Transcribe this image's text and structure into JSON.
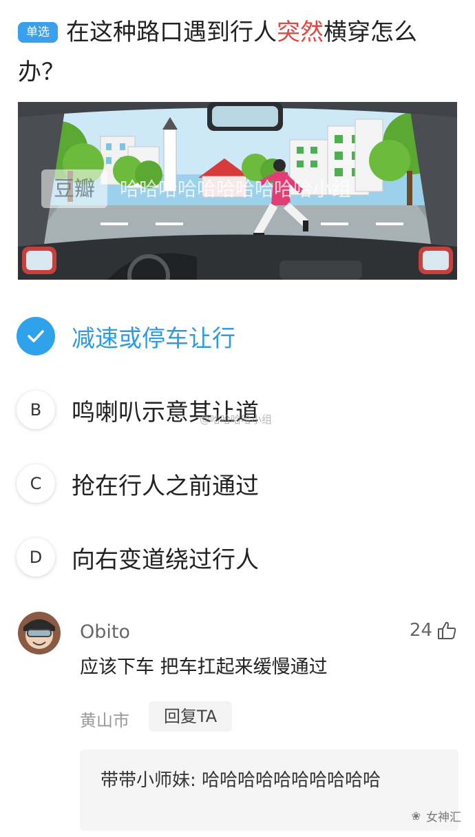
{
  "question": {
    "tag": "单选",
    "text_before": "在这种路口遇到行人",
    "text_highlight": "突然",
    "text_after": "横穿怎么办？",
    "highlight_color": "#e2483d"
  },
  "image": {
    "watermark_logo": "豆瓣",
    "watermark_text": "哈哈哈哈哈哈哈哈哈哈小组"
  },
  "options": [
    {
      "key": "A",
      "text": "减速或停车让行",
      "selected": true
    },
    {
      "key": "B",
      "text": "鸣喇叭示意其让道",
      "selected": false
    },
    {
      "key": "C",
      "text": "抢在行人之前通过",
      "selected": false
    },
    {
      "key": "D",
      "text": "向右变道绕过行人",
      "selected": false
    }
  ],
  "comment": {
    "username": "Obito",
    "likes": "24",
    "text": "应该下车 把车扛起来缓慢通过",
    "location": "黄山市",
    "reply_label": "回复TA",
    "sub_reply": "带带小师妹: 哈哈哈哈哈哈哈哈哈哈"
  },
  "watermarks": {
    "center": "@哈哈哈哈小组",
    "bottom_right": "女神汇"
  },
  "colors": {
    "accent": "#2ea3ec",
    "selected_text": "#2e9ae6",
    "highlight": "#e2483d"
  }
}
